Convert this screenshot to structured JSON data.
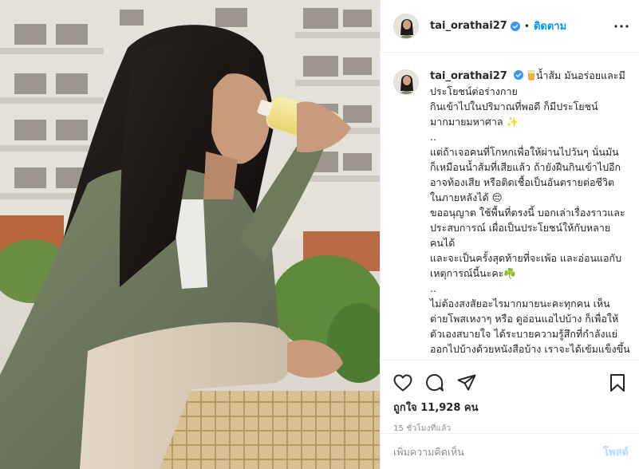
{
  "post": {
    "username": "tai_orathai27",
    "follow_label": "ติดตาม",
    "separator": "•",
    "verified": true
  },
  "caption": {
    "username": "tai_orathai27",
    "lines": [
      "น้ำส้ม มันอร่อยและมี",
      "ประโยชน์ต่อร่างกาย",
      "กินเข้าไปในปริมาณที่พอดี ก็มีประโยชน์",
      "มากมายมหาศาล ✨",
      "..",
      "แต่ถ้าเจอคนที่โกหกเพื่อให้ผ่านไปวันๆ นั่นมัน",
      "ก็เหมือนน้ำส้มที่เสียแล้ว ถ้ายังฝืนกินเข้าไปอีก",
      "อาจท้องเสีย หรือติดเชื้อเป็นอันตรายต่อชีวิต",
      "ในภายหลังได้ 😔",
      "",
      "ขออนุญาต ใช้พื้นที่ตรงนี้ บอกเล่าเรื่องราวและ",
      "ประสบการณ์ เผื่อเป็นประโยชน์ให้กับหลาย",
      "คนได้",
      "และจะเป็นครั้งสุดท้ายที่จะเพ้อ และอ่อนแอกับ",
      "เหตุการณ์นี้นะคะ☘️",
      "..",
      "ไม่ต้องสงสัยอะไรมากมายนะคะทุกคน เห็น",
      "ต่ายโพสเหงาๆ หรือ ดูอ่อนแอไปบ้าง ก็เพื่อให้",
      "ตัวเองสบายใจ ได้ระบายความรู้สึกที่กำลังแย่",
      "ออกไปบ้างด้วยหนังสือบ้าง เราจะได้เข้มแข็งขึ้น"
    ]
  },
  "icons": {
    "like": "heart-icon",
    "comment": "comment-bubble-icon",
    "share": "paper-plane-icon",
    "save": "bookmark-icon",
    "more": "more-horizontal-icon",
    "verified": "verified-badge-icon"
  },
  "stats": {
    "likes_text": "ถูกใจ 11,928 คน",
    "time_text": "15 ชั่วโมงที่แล้ว"
  },
  "comment_box": {
    "placeholder": "เพิ่มความคิดเห็น",
    "post_label": "โพสต์"
  },
  "colors": {
    "accent": "#0095f6",
    "post_disabled": "#b3dbff",
    "muted": "#8e8e8e",
    "border": "#efefef"
  }
}
